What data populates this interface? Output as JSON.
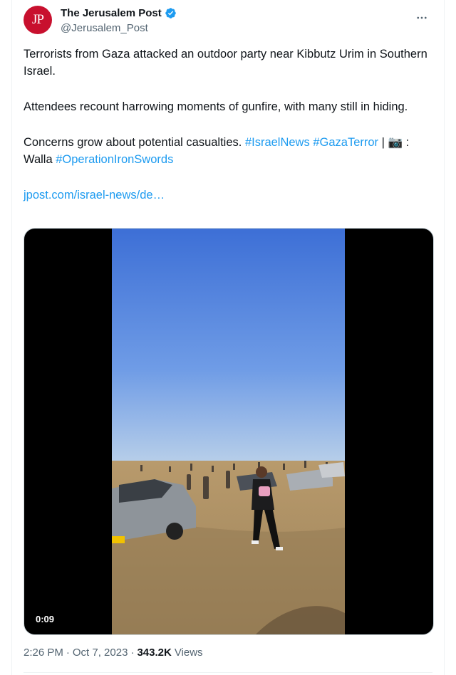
{
  "account": {
    "display_name": "The Jerusalem Post",
    "handle": "@Jerusalem_Post",
    "avatar_initials": "JP",
    "avatar_color": "#c8102e",
    "verified_color": "#1d9bf0"
  },
  "tweet": {
    "paragraph1": "Terrorists from Gaza attacked an outdoor party near Kibbutz Urim in Southern Israel.",
    "paragraph2": "Attendees recount harrowing moments of gunfire, with many still in hiding.",
    "paragraph3_text": "Concerns grow about potential casualties. ",
    "hashtag1": "#IsraelNews",
    "hashtag2": "#GazaTerror",
    "separator": " | ",
    "camera_emoji": "📷",
    "credit": " : Walla ",
    "hashtag3": "#OperationIronSwords",
    "link": "jpost.com/israel-news/de…"
  },
  "media": {
    "duration": "0:09"
  },
  "meta": {
    "time": "2:26 PM",
    "dot": "·",
    "date": "Oct 7, 2023",
    "dot2": "·",
    "views_count": "343.2K",
    "views_label": "Views"
  },
  "colors": {
    "text": "#0f1419",
    "secondary": "#536471",
    "link": "#1d9bf0"
  }
}
